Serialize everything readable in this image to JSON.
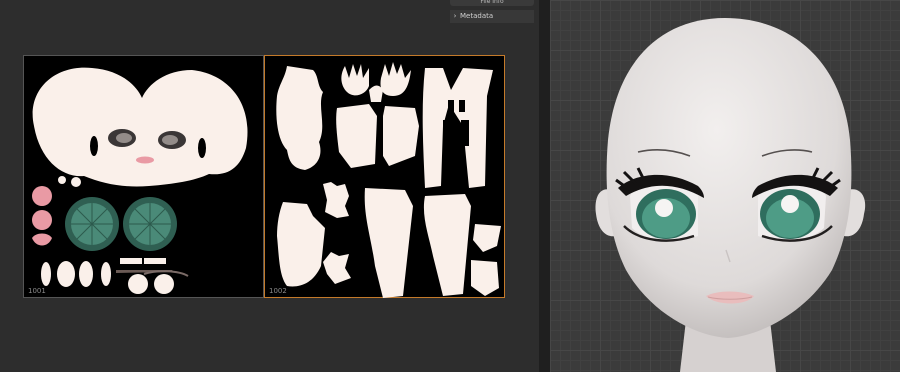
{
  "toolbar": {
    "top_button_label": "File Info"
  },
  "panel": {
    "metadata_label": "Metadata",
    "chevron": "›"
  },
  "uv_editor": {
    "tiles": [
      {
        "id": "tile-1001",
        "label": "1001"
      },
      {
        "id": "tile-1002",
        "label": "1002"
      }
    ]
  },
  "colors": {
    "skin": "#faf0ea",
    "eye_green": "#3f7a68",
    "cheek_pink": "#e99aa4",
    "active_tile_border": "#c47a2a",
    "viewport_bg": "#3b3b3b"
  }
}
